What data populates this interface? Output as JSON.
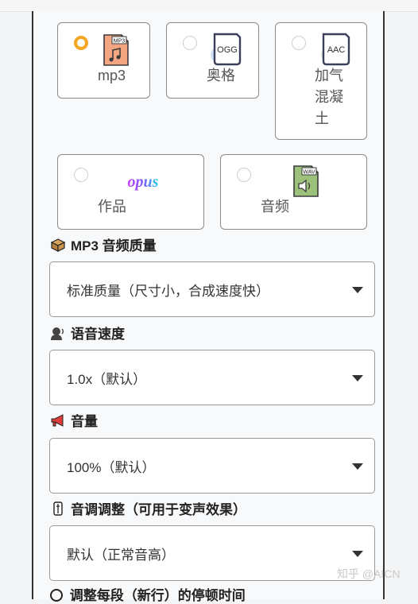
{
  "formats": [
    {
      "id": "mp3",
      "label": "mp3",
      "selected": true,
      "icon": "mp3-file-icon",
      "icon_text": "MP3"
    },
    {
      "id": "ogg",
      "label": "奥格",
      "selected": false,
      "icon": "ogg-file-icon",
      "icon_text": "OGG"
    },
    {
      "id": "aac",
      "label_lines": [
        "加气",
        "混凝",
        "土"
      ],
      "selected": false,
      "icon": "aac-file-icon",
      "icon_text": "AAC"
    },
    {
      "id": "opus",
      "label": "作品",
      "selected": false,
      "icon": "opus-logo-icon",
      "icon_text": "opus"
    },
    {
      "id": "wav",
      "label": "音频",
      "selected": false,
      "icon": "wav-file-icon",
      "icon_text": "WAV"
    }
  ],
  "quality": {
    "label": "MP3 音频质量",
    "value": "标准质量（尺寸小，合成速度快）",
    "icon": "package-icon"
  },
  "speed": {
    "label": "语音速度",
    "value": "1.0x（默认）",
    "icon": "speaker-person-icon"
  },
  "volume": {
    "label": "音量",
    "value": "100%（默认）",
    "icon": "megaphone-icon"
  },
  "pitch": {
    "label": "音调调整（可用于变声效果）",
    "value": "默认（正常音高）",
    "icon": "tuning-fork-icon"
  },
  "next_section": {
    "label": "调整每段（新行）的停顿时间"
  },
  "watermark": "知乎 @AICN",
  "colors": {
    "accent": "#f5a623",
    "mp3_icon": "#f4a582",
    "aac_icon": "#5c7cfa",
    "wav_icon": "#9bc17a"
  }
}
